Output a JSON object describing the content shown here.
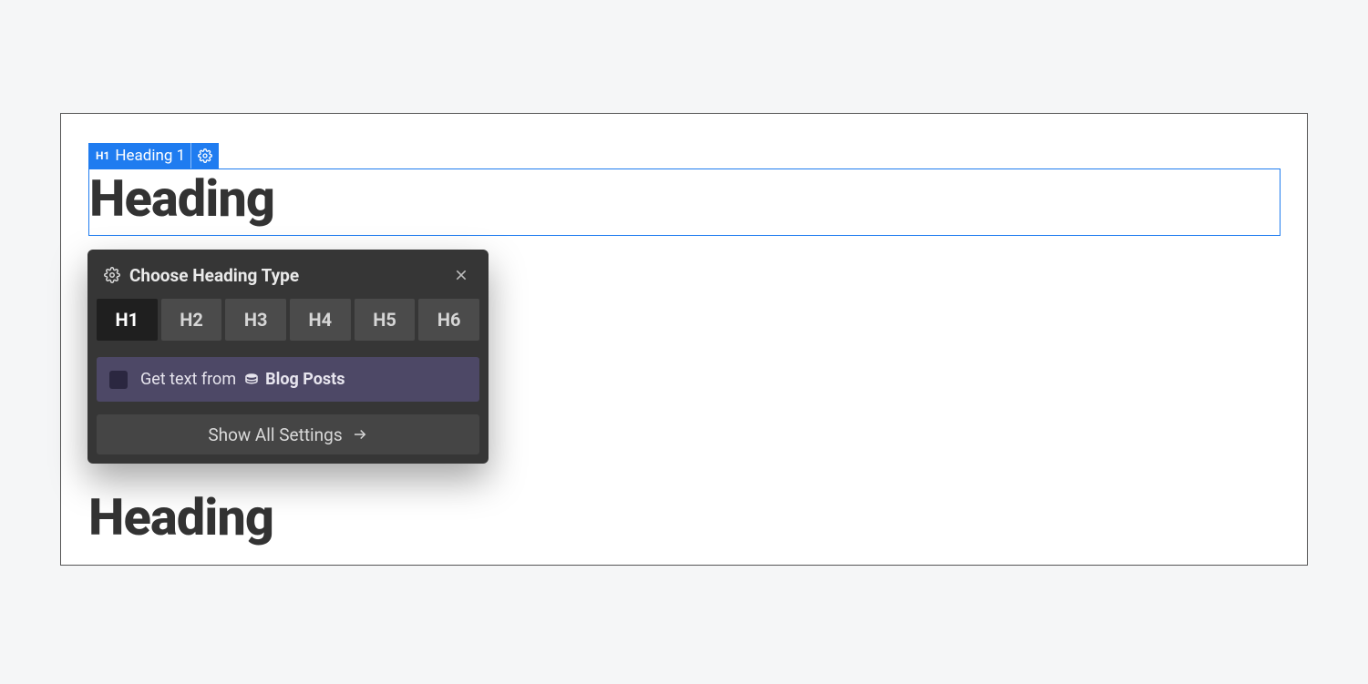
{
  "selection": {
    "tag": "H1",
    "label": "Heading 1",
    "text": "Heading"
  },
  "other_heading_text": "Heading",
  "popover": {
    "title": "Choose Heading Type",
    "heading_options": [
      "H1",
      "H2",
      "H3",
      "H4",
      "H5",
      "H6"
    ],
    "active_option": "H1",
    "cms": {
      "prefix": "Get text from",
      "collection": "Blog Posts"
    },
    "show_all_label": "Show All Settings"
  }
}
